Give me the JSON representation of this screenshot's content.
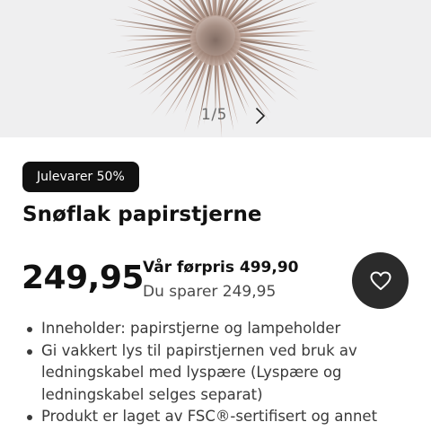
{
  "gallery": {
    "current": "1",
    "separator": "/",
    "total": "5",
    "next_icon": "chevron-right-icon"
  },
  "product": {
    "badge": "Julevarer 50%",
    "title": "Snøflak papirstjerne",
    "price": "249,95",
    "before_price": "Vår førpris 499,90",
    "savings": "Du sparer 249,95",
    "favorite_icon": "heart-icon",
    "features": [
      "Inneholder: papirstjerne og lampeholder",
      "Gi vakkert lys til papirstjernen ved bruk av ledningskabel med lyspære (Lyspære og ledningskabel selges separat)",
      "Produkt er laget av FSC®-sertifisert og annet"
    ]
  },
  "colors": {
    "badge_bg": "#111111",
    "favorite_bg": "#2b2b2b",
    "hero_bg": "#efeff0",
    "star": "#b09587"
  }
}
